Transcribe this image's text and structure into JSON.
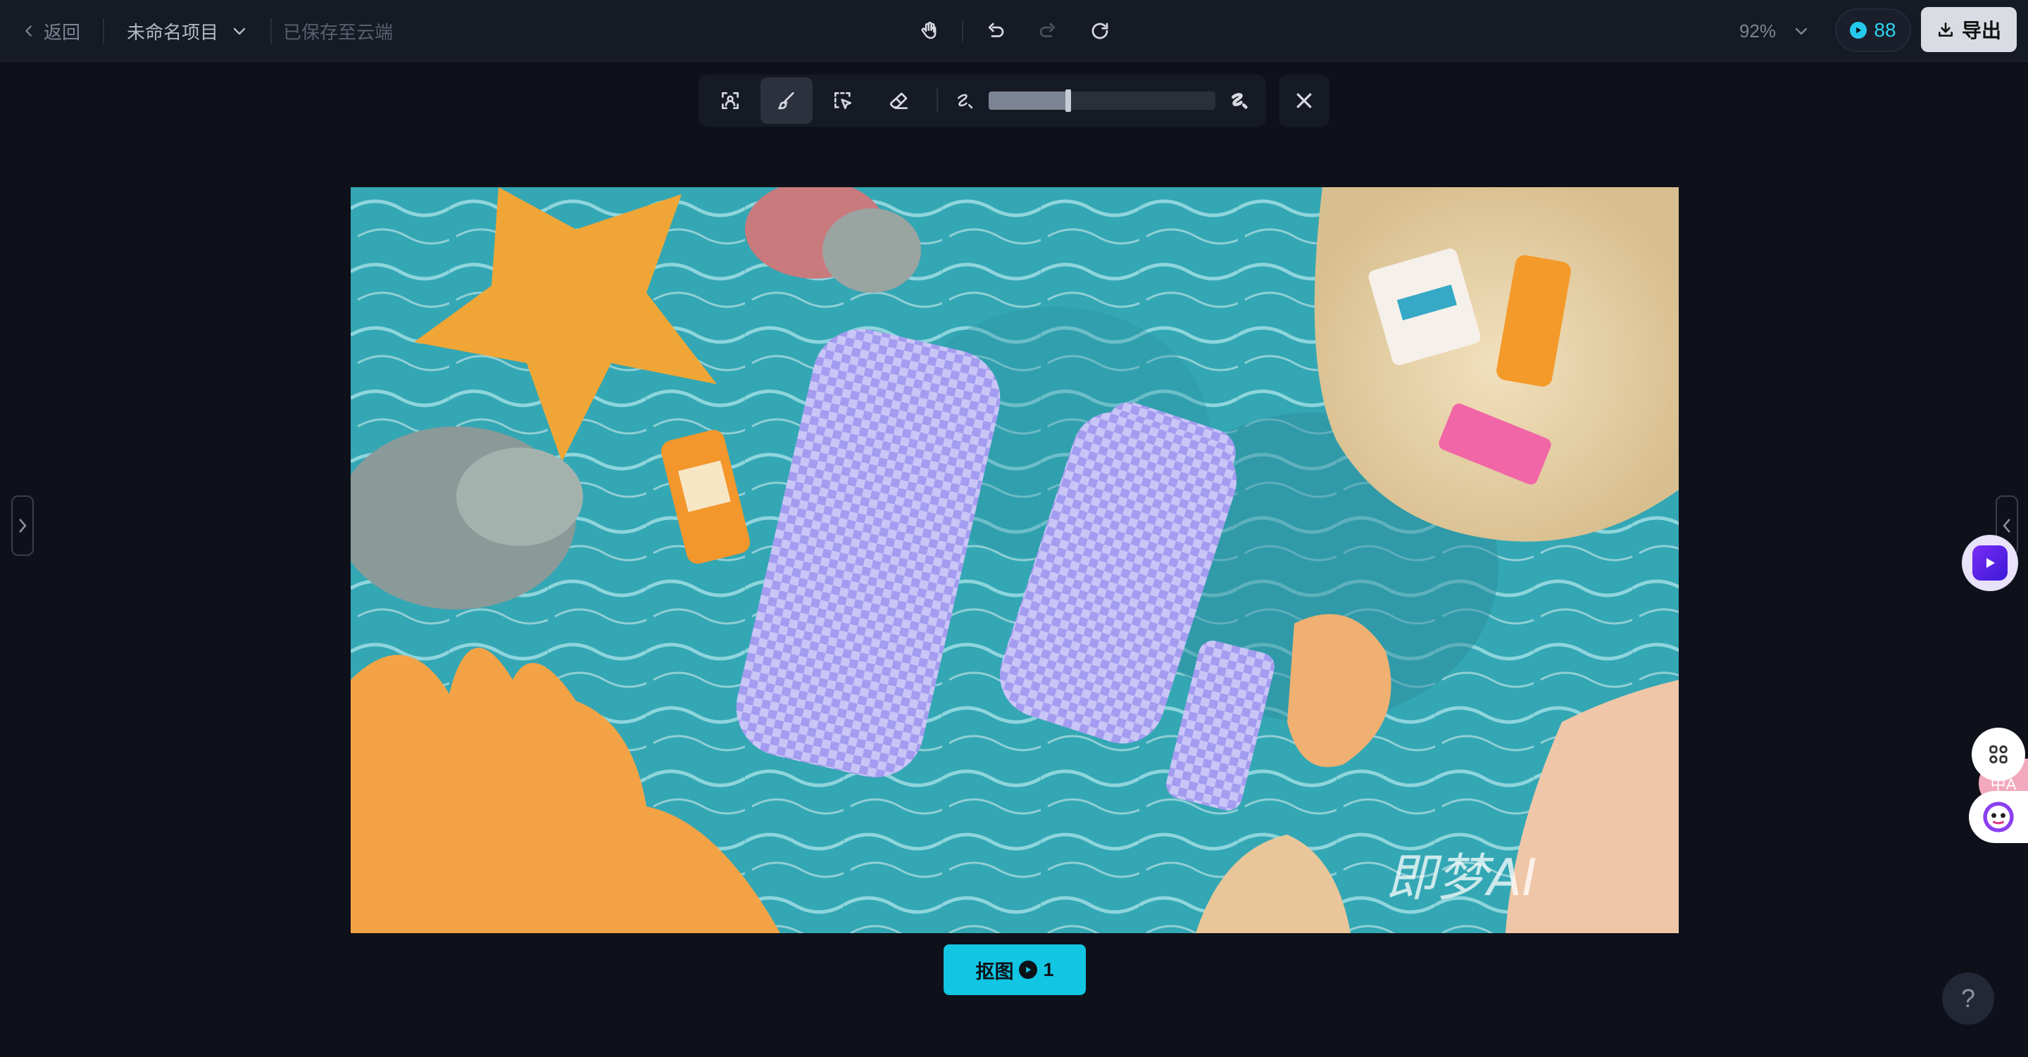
{
  "topbar": {
    "back_label": "返回",
    "project_name": "未命名项目",
    "save_status": "已保存至云端",
    "zoom": "92%",
    "credits": "88",
    "export_label": "导出"
  },
  "canvas": {
    "watermark": "即梦AI"
  },
  "actions": {
    "cutout_label": "抠图",
    "cutout_cost": "1"
  },
  "brush": {
    "size_fraction": 0.35
  },
  "side": {
    "pink_badge": "中A"
  },
  "help": {
    "label": "?"
  },
  "colors": {
    "accent": "#12c6e3",
    "credit": "#2fd3f0",
    "background": "#0e111a",
    "toolbar": "#161a24",
    "mask": "#a59cf0"
  },
  "icons": [
    "chevron-left-icon",
    "chevron-down-icon",
    "hand-icon",
    "undo-icon",
    "redo-icon",
    "refresh-icon",
    "credit-icon",
    "download-icon",
    "person-select-icon",
    "brush-icon",
    "smart-select-icon",
    "eraser-icon",
    "brush-small-icon",
    "brush-large-icon",
    "close-icon",
    "video-icon",
    "apps-icon",
    "bot-icon"
  ]
}
